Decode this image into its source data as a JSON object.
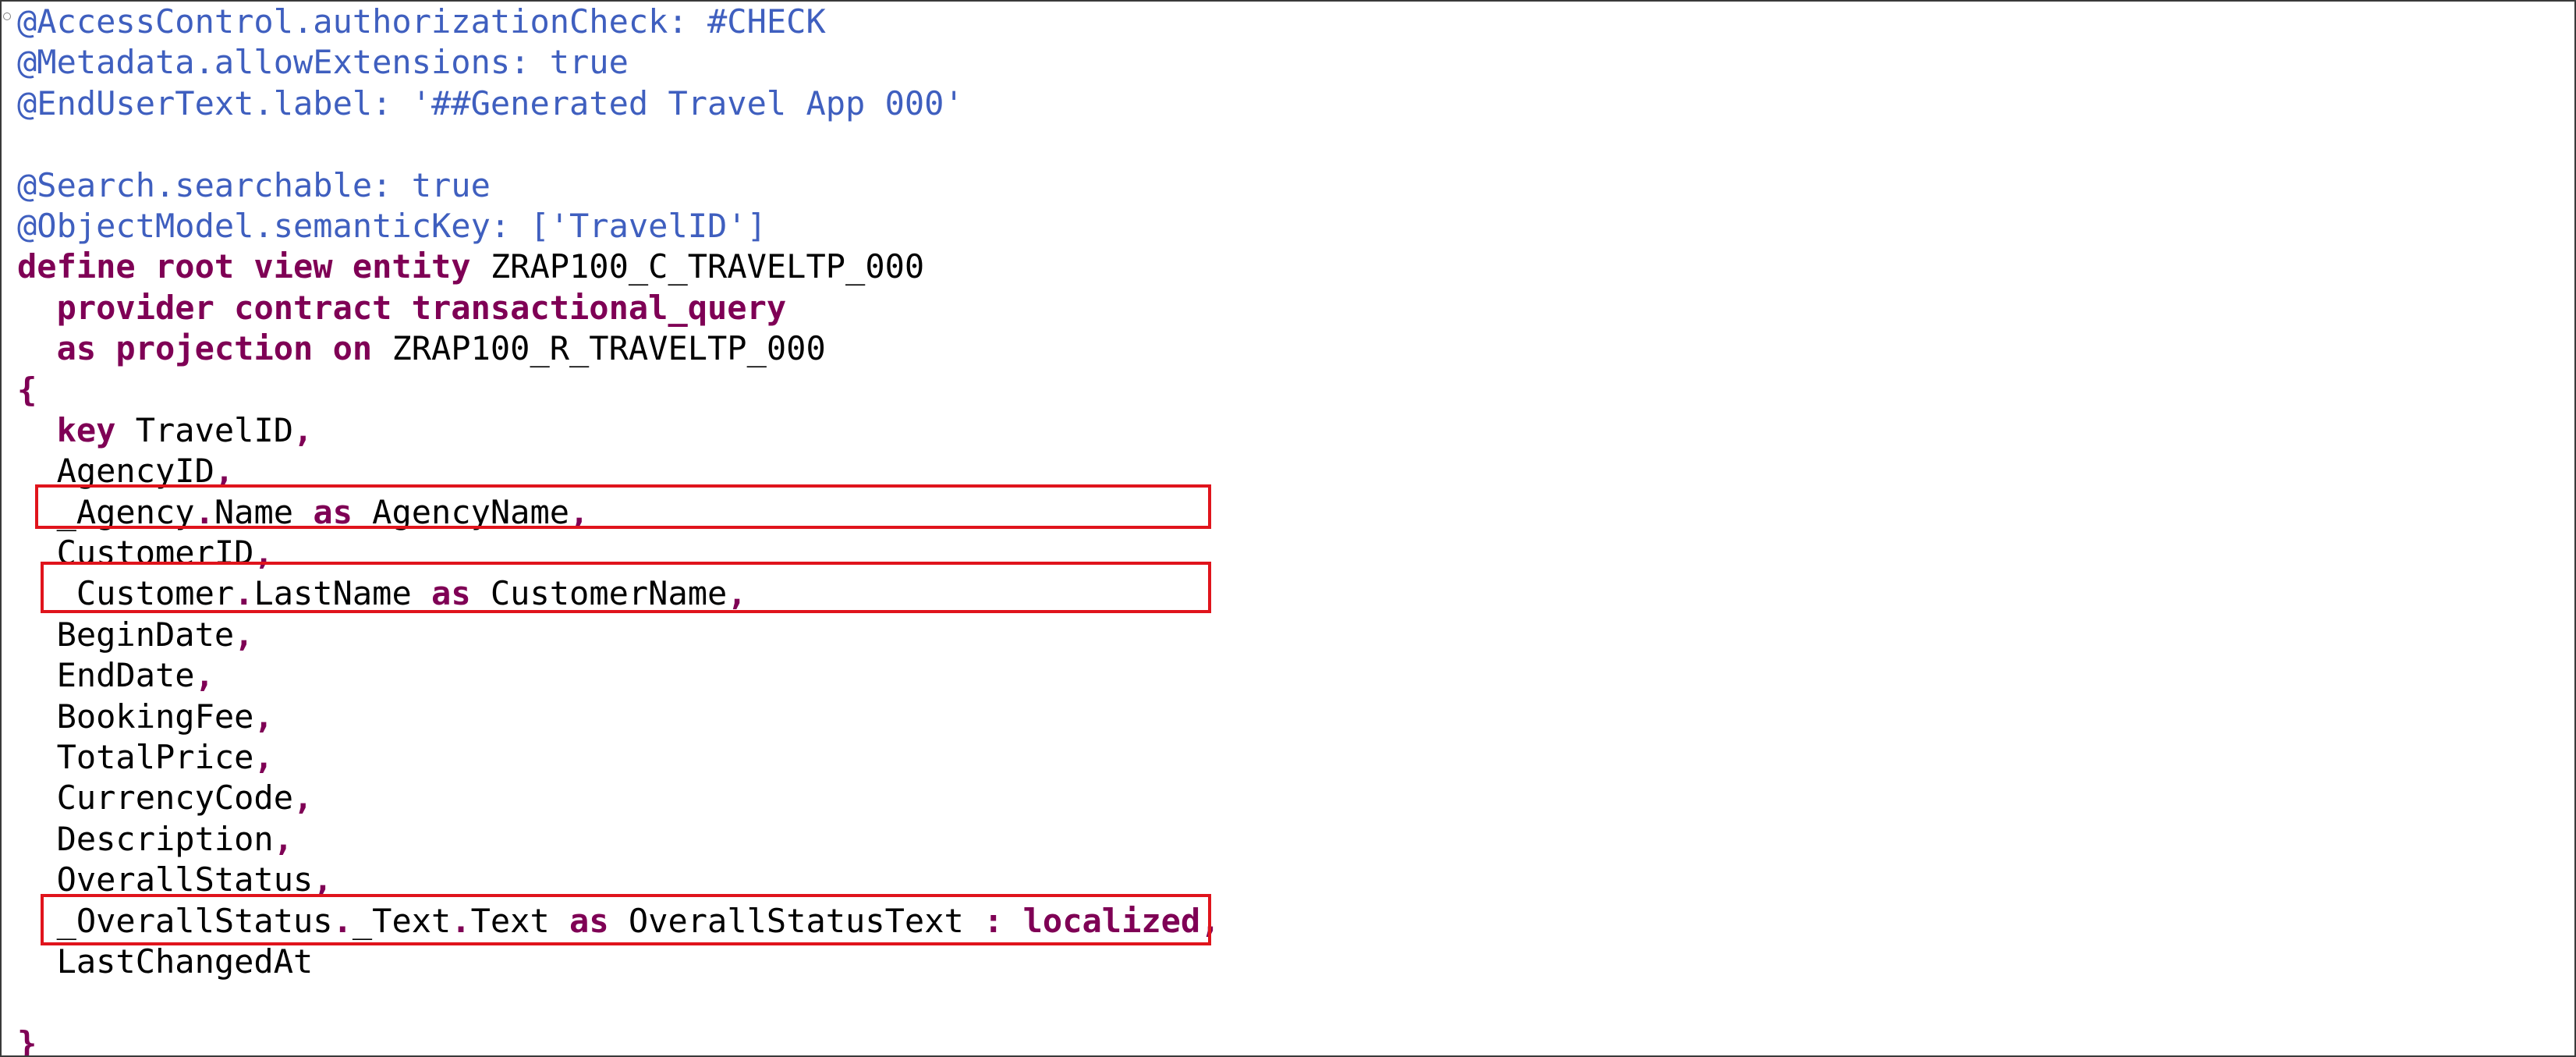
{
  "editor": {
    "lines": [
      [
        {
          "t": "@AccessControl.authorizationCheck: #CHECK",
          "c": "ann"
        }
      ],
      [
        {
          "t": "@Metadata.allowExtensions: true",
          "c": "ann"
        }
      ],
      [
        {
          "t": "@EndUserText.label: '##Generated Travel App 000'",
          "c": "ann"
        }
      ],
      [],
      [
        {
          "t": "@Search.searchable: true",
          "c": "ann"
        }
      ],
      [
        {
          "t": "@ObjectModel.semanticKey: ['TravelID']",
          "c": "ann"
        }
      ],
      [
        {
          "t": "define root view entity",
          "c": "kw"
        },
        {
          "t": " ZRAP100_C_TRAVELTP_000",
          "c": "pl"
        }
      ],
      [
        {
          "t": "  ",
          "c": "pl"
        },
        {
          "t": "provider contract transactional_query",
          "c": "kw"
        }
      ],
      [
        {
          "t": "  ",
          "c": "pl"
        },
        {
          "t": "as projection on",
          "c": "kw"
        },
        {
          "t": " ZRAP100_R_TRAVELTP_000",
          "c": "pl"
        }
      ],
      [
        {
          "t": "{",
          "c": "pn"
        }
      ],
      [
        {
          "t": "  ",
          "c": "pl"
        },
        {
          "t": "key",
          "c": "kw"
        },
        {
          "t": " TravelID",
          "c": "pl"
        },
        {
          "t": ",",
          "c": "pn"
        }
      ],
      [
        {
          "t": "  AgencyID",
          "c": "pl"
        },
        {
          "t": ",",
          "c": "pn"
        }
      ],
      [
        {
          "t": "  _Agency",
          "c": "pl"
        },
        {
          "t": ".",
          "c": "pn"
        },
        {
          "t": "Name ",
          "c": "pl"
        },
        {
          "t": "as",
          "c": "kw"
        },
        {
          "t": " AgencyName",
          "c": "pl"
        },
        {
          "t": ",",
          "c": "pn"
        }
      ],
      [
        {
          "t": "  CustomerID",
          "c": "pl"
        },
        {
          "t": ",",
          "c": "pn"
        }
      ],
      [
        {
          "t": "  _Customer",
          "c": "pl"
        },
        {
          "t": ".",
          "c": "pn"
        },
        {
          "t": "LastName ",
          "c": "pl"
        },
        {
          "t": "as",
          "c": "kw"
        },
        {
          "t": " CustomerName",
          "c": "pl"
        },
        {
          "t": ",",
          "c": "pn"
        }
      ],
      [
        {
          "t": "  BeginDate",
          "c": "pl"
        },
        {
          "t": ",",
          "c": "pn"
        }
      ],
      [
        {
          "t": "  EndDate",
          "c": "pl"
        },
        {
          "t": ",",
          "c": "pn"
        }
      ],
      [
        {
          "t": "  BookingFee",
          "c": "pl"
        },
        {
          "t": ",",
          "c": "pn"
        }
      ],
      [
        {
          "t": "  TotalPrice",
          "c": "pl"
        },
        {
          "t": ",",
          "c": "pn"
        }
      ],
      [
        {
          "t": "  CurrencyCode",
          "c": "pl"
        },
        {
          "t": ",",
          "c": "pn"
        }
      ],
      [
        {
          "t": "  Description",
          "c": "pl"
        },
        {
          "t": ",",
          "c": "pn"
        }
      ],
      [
        {
          "t": "  OverallStatus",
          "c": "pl"
        },
        {
          "t": ",",
          "c": "pn"
        }
      ],
      [
        {
          "t": "  _OverallStatus",
          "c": "pl"
        },
        {
          "t": ".",
          "c": "pn"
        },
        {
          "t": "_Text",
          "c": "pl"
        },
        {
          "t": ".",
          "c": "pn"
        },
        {
          "t": "Text ",
          "c": "pl"
        },
        {
          "t": "as",
          "c": "kw"
        },
        {
          "t": " OverallStatusText ",
          "c": "pl"
        },
        {
          "t": ": localized,",
          "c": "kw"
        }
      ],
      [
        {
          "t": "  LastChangedAt",
          "c": "pl"
        }
      ],
      [],
      [
        {
          "t": "}",
          "c": "pn"
        }
      ]
    ]
  },
  "colors": {
    "annotation": "#3f5fbf",
    "keyword": "#7f0055",
    "plain": "#000000",
    "highlight_border": "#e0141c",
    "frame_border": "#3a3a3a"
  },
  "icons": {
    "fold": "fold-marker-icon"
  }
}
